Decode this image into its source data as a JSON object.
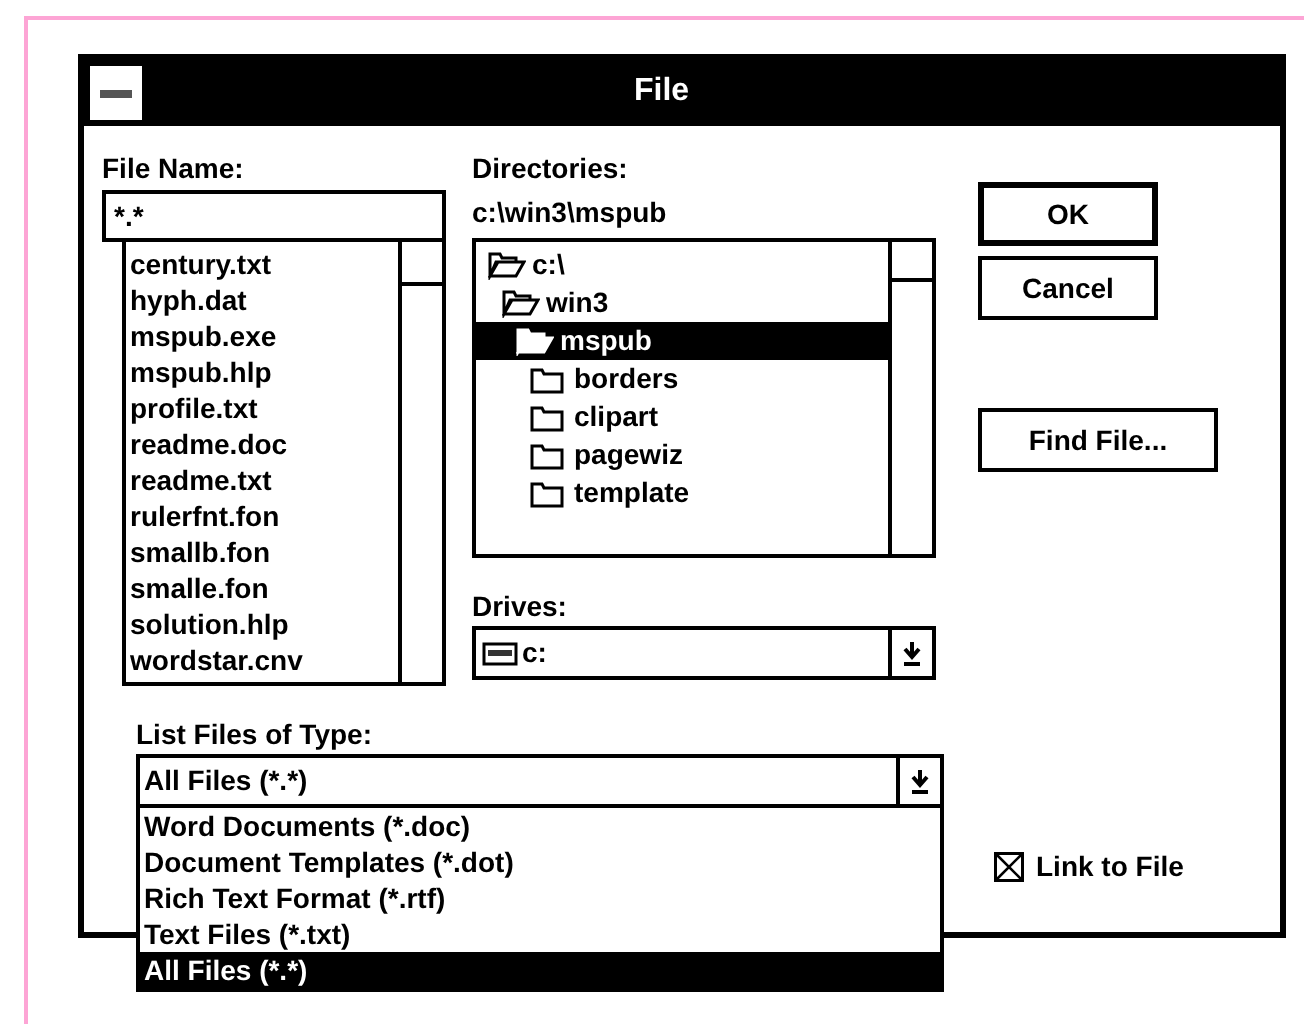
{
  "window": {
    "title": "File"
  },
  "file_name": {
    "label": "File Name:",
    "value": "*.*"
  },
  "files": [
    "century.txt",
    "hyph.dat",
    "mspub.exe",
    "mspub.hlp",
    "profile.txt",
    "readme.doc",
    "readme.txt",
    "rulerfnt.fon",
    "smallb.fon",
    "smalle.fon",
    "solution.hlp",
    "wordstar.cnv"
  ],
  "directories": {
    "label": "Directories:",
    "path": "c:\\win3\\mspub",
    "tree": [
      {
        "name": "c:\\",
        "open": true,
        "selected": false,
        "children": [
          {
            "name": "win3",
            "open": true,
            "selected": false,
            "children": [
              {
                "name": "mspub",
                "open": true,
                "selected": true,
                "children": [
                  {
                    "name": "borders",
                    "open": false,
                    "selected": false
                  },
                  {
                    "name": "clipart",
                    "open": false,
                    "selected": false
                  },
                  {
                    "name": "pagewiz",
                    "open": false,
                    "selected": false
                  },
                  {
                    "name": "template",
                    "open": false,
                    "selected": false
                  }
                ]
              }
            ]
          }
        ]
      }
    ]
  },
  "drives": {
    "label": "Drives:",
    "value": "c:"
  },
  "file_type": {
    "label": "List Files of Type:",
    "value": "All Files (*.*)",
    "options": [
      {
        "label": "Word Documents (*.doc)",
        "selected": false
      },
      {
        "label": "Document Templates (*.dot)",
        "selected": false
      },
      {
        "label": "Rich Text Format (*.rtf)",
        "selected": false
      },
      {
        "label": "Text Files (*.txt)",
        "selected": false
      },
      {
        "label": "All Files (*.*)",
        "selected": true
      }
    ]
  },
  "buttons": [
    {
      "label": "OK",
      "default": true
    },
    {
      "label": "Cancel",
      "default": false
    },
    {
      "label": "Find File...",
      "default": false
    }
  ],
  "link_to_file": {
    "label": "Link to File",
    "checked": true
  }
}
